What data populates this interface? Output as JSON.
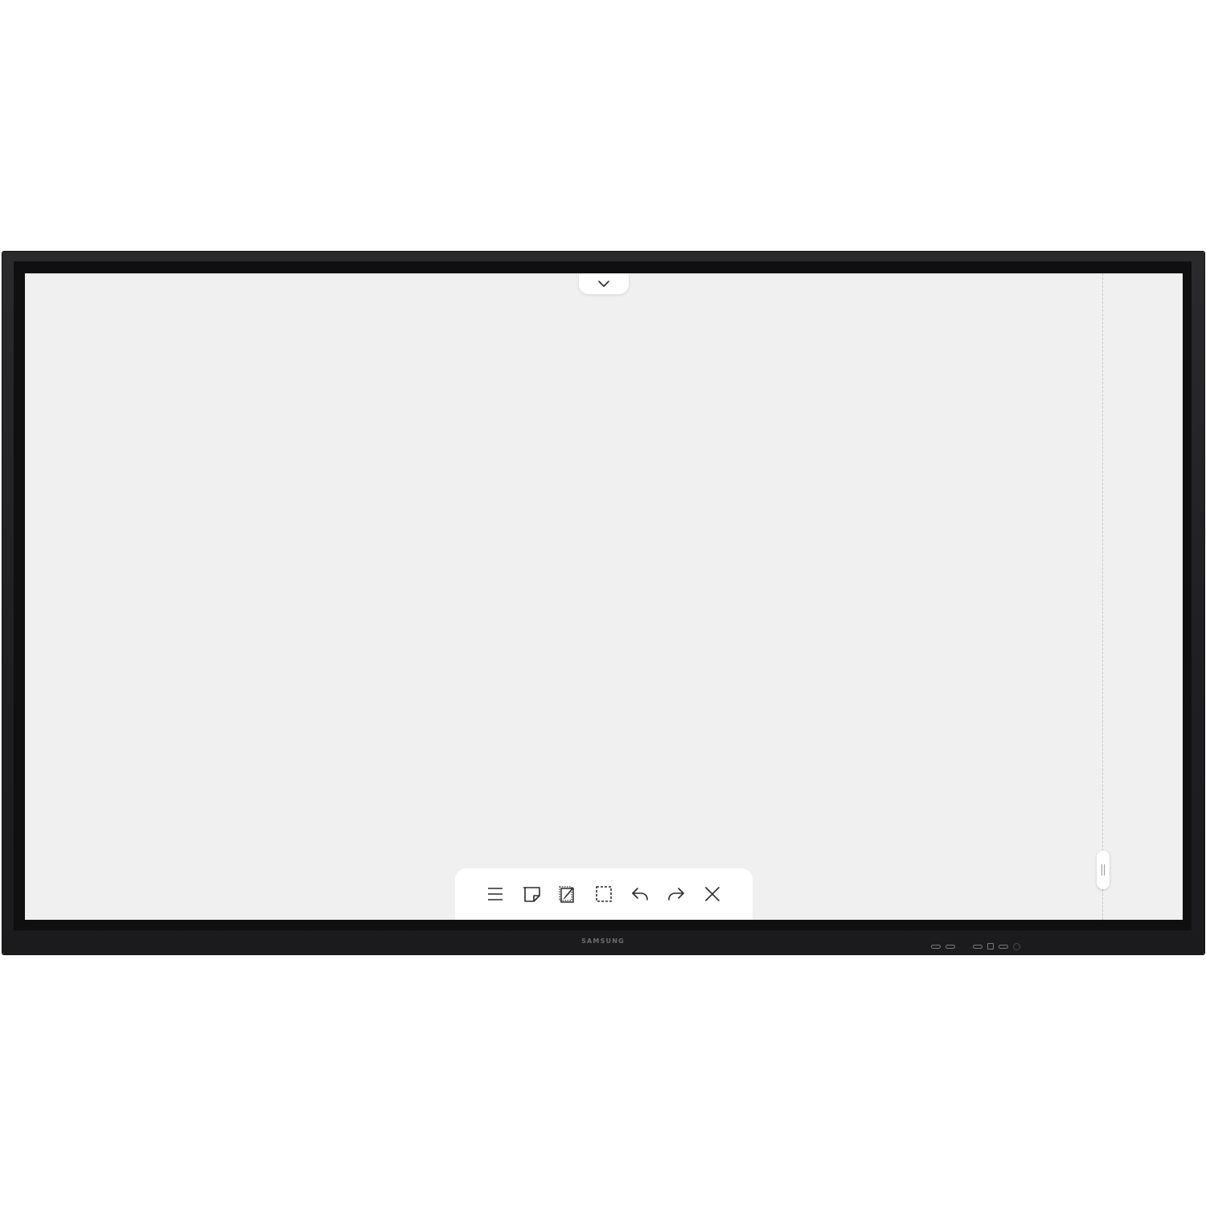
{
  "device": {
    "brand_label": "SAMSUNG",
    "colors": {
      "bezel": "#1f1f21",
      "screen": "#f0f0f0",
      "toolbar": "#ffffff",
      "icon": "#2b2b2b",
      "divider": "#c8c8c8"
    }
  },
  "top_tab": {
    "icon": "chevron-down-icon"
  },
  "side_handle": {
    "icon": "drag-handle-icon"
  },
  "toolbar": {
    "tools": [
      {
        "name": "menu-button",
        "icon": "hamburger-menu-icon"
      },
      {
        "name": "sticky-note-button",
        "icon": "sticky-note-icon"
      },
      {
        "name": "edit-page-button",
        "icon": "edit-page-icon"
      },
      {
        "name": "select-button",
        "icon": "dashed-selection-icon"
      },
      {
        "name": "undo-button",
        "icon": "undo-icon"
      },
      {
        "name": "redo-button",
        "icon": "redo-icon"
      },
      {
        "name": "close-button",
        "icon": "close-icon"
      }
    ]
  }
}
